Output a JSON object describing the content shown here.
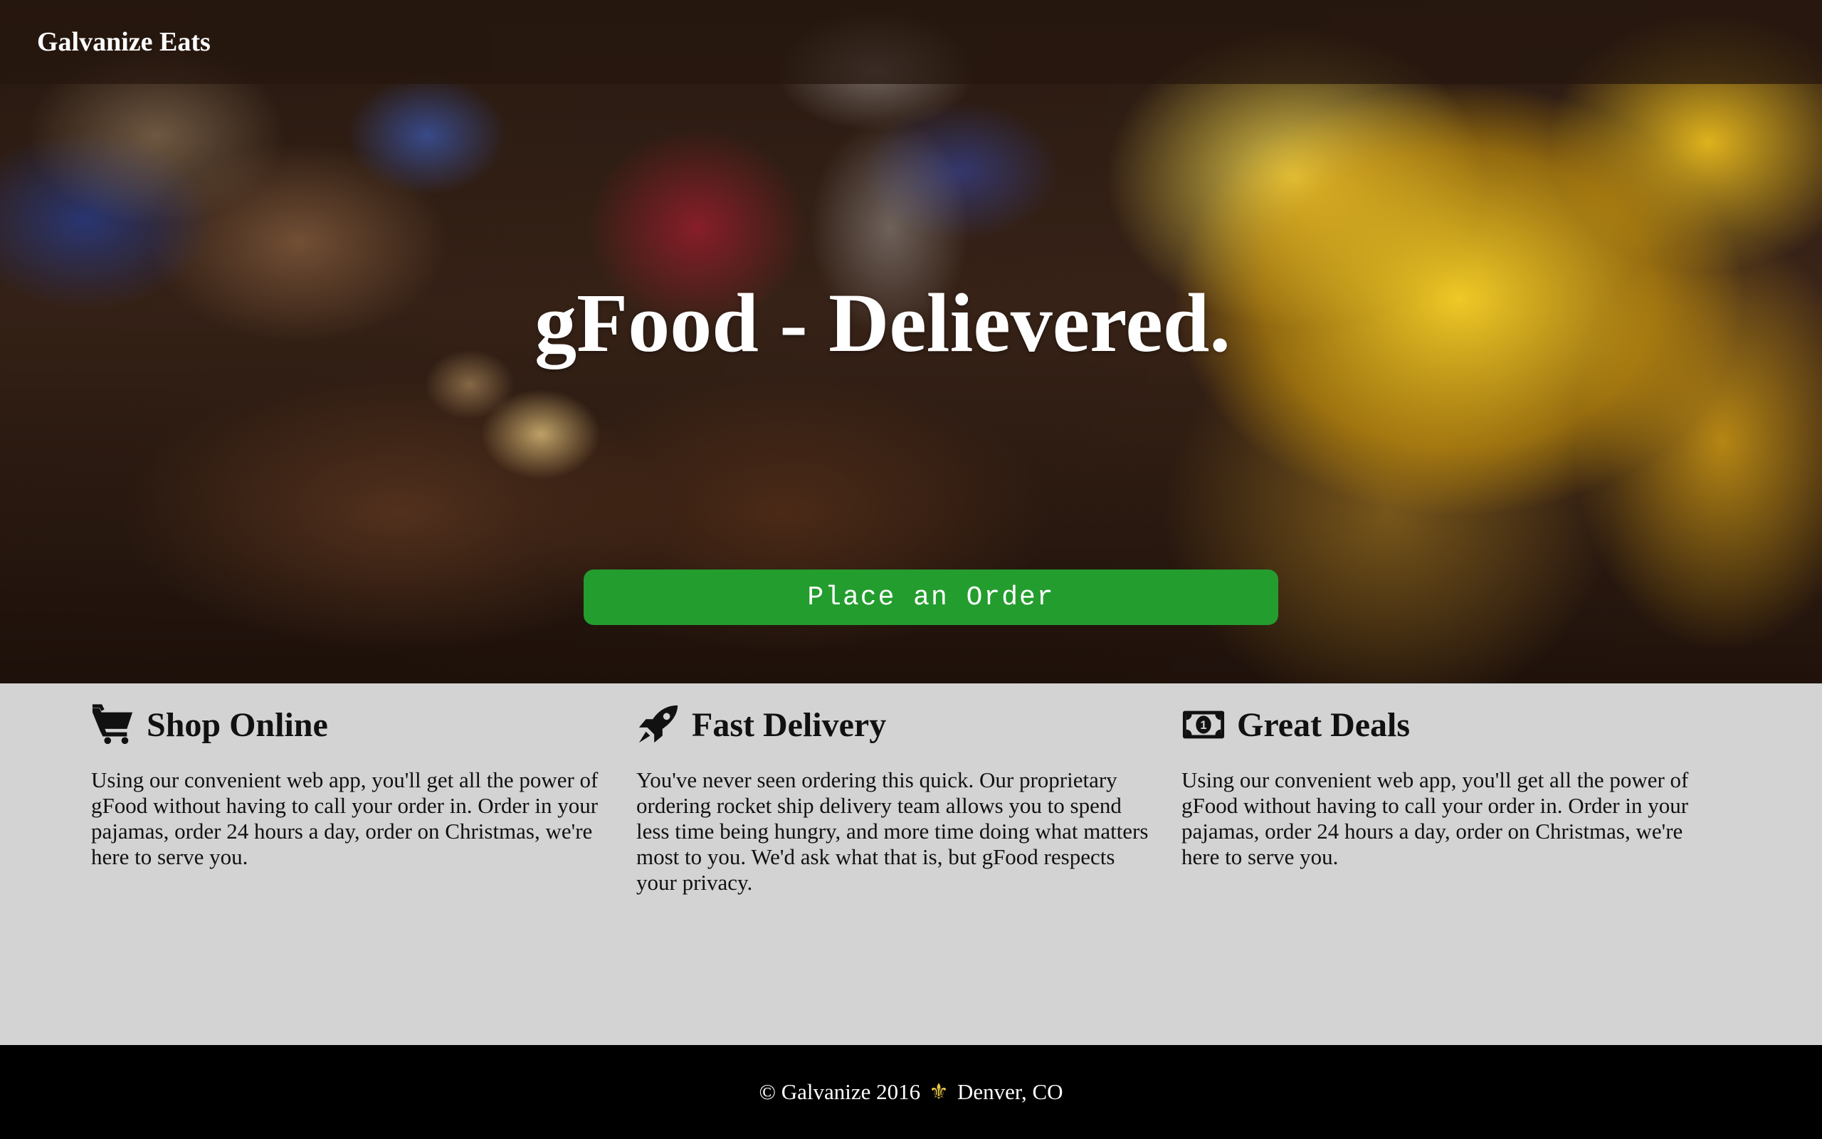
{
  "navbar": {
    "brand": "Galvanize Eats"
  },
  "hero": {
    "headline": "gFood - Delievered.",
    "button_label": "Place an Order"
  },
  "features": [
    {
      "icon": "shopping-cart-icon",
      "title": "Shop Online",
      "text": "Using our convenient web app, you'll get all the power of gFood without having to call your order in. Order in your pajamas, order 24 hours a day, order on Christmas, we're here to serve you."
    },
    {
      "icon": "rocket-icon",
      "title": "Fast Delivery",
      "text": "You've never seen ordering this quick. Our proprietary ordering rocket ship delivery team allows you to spend less time being hungry, and more time doing what matters most to you. We'd ask what that is, but gFood respects your privacy."
    },
    {
      "icon": "money-bill-icon",
      "title": "Great Deals",
      "text": "Using our convenient web app, you'll get all the power of gFood without having to call your order in. Order in your pajamas, order 24 hours a day, order on Christmas, we're here to serve you."
    }
  ],
  "footer": {
    "copyright": "© Galvanize 2016",
    "separator": "⚜",
    "location": "Denver, CO"
  },
  "colors": {
    "button_green": "#239d2e",
    "features_bg": "#d3d3d3",
    "footer_bg": "#000000",
    "fleur_gold": "#e8c64a"
  }
}
